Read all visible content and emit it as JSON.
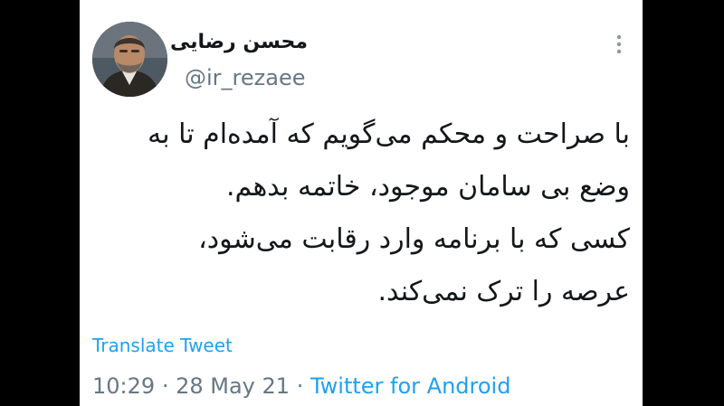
{
  "author": {
    "name": "محسن رضایی",
    "handle": "@ir_rezaee",
    "avatar_icon": "user-portrait-icon"
  },
  "menu_icon": "more-vertical-icon",
  "tweet": {
    "lines": [
      "با صراحت و محکم می‌گویم که آمده‌ام تا به",
      "وضع بی سامان موجود، خاتمه بدهم.",
      "کسی که با برنامه وارد رقابت می‌شود،",
      "عرصه را ترک نمی‌کند."
    ]
  },
  "translate_label": "Translate Tweet",
  "meta": {
    "time": "10:29",
    "separator": "·",
    "date": "28 May 21",
    "source": "Twitter for Android"
  },
  "colors": {
    "link": "#1da1f2",
    "secondary_text": "#657786",
    "primary_text": "#14171a",
    "background_outer": "#000000",
    "card": "#ffffff"
  }
}
